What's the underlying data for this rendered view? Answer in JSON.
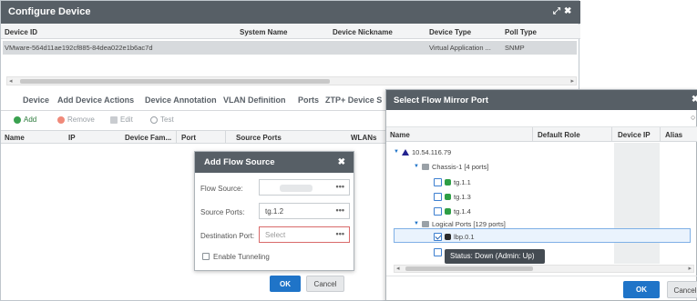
{
  "configure_device": {
    "title": "Configure Device",
    "maximize_glyph": "⤢",
    "close_glyph": "✖",
    "columns": [
      "Device ID",
      "System Name",
      "Device Nickname",
      "Device Type",
      "Poll Type"
    ],
    "row": {
      "device_id": "VMware-564d11ae192cf885-84dea022e1b6ac7d",
      "system_name": "",
      "device_nickname": "",
      "device_type": "Virtual Application ...",
      "poll_type": "SNMP"
    },
    "scroll_left": "◂",
    "scroll_right": "▸",
    "tabs": [
      "Device",
      "Add Device Actions",
      "Device Annotation",
      "VLAN Definition",
      "Ports",
      "ZTP+ Device S"
    ],
    "toolbar": {
      "add": "Add",
      "remove": "Remove",
      "edit": "Edit",
      "test": "Test"
    },
    "grid_columns": [
      "Name",
      "IP",
      "Device Fam...",
      "Port",
      "Source Ports",
      "WLANs"
    ]
  },
  "add_flow_source": {
    "title": "Add Flow Source",
    "close_glyph": "✖",
    "flow_source_label": "Flow Source:",
    "source_ports_label": "Source Ports:",
    "source_ports_value": "tg.1.2",
    "destination_port_label": "Destination Port:",
    "destination_port_placeholder": "Select",
    "dots": "•••",
    "enable_tunneling_label": "Enable Tunneling",
    "ok": "OK",
    "cancel": "Cancel"
  },
  "select_flow_mirror_port": {
    "title": "Select Flow Mirror Port",
    "close_glyph": "✖",
    "search_glyph": "○",
    "columns": [
      "Name",
      "Default Role",
      "Device IP",
      "Alias"
    ],
    "tree": {
      "root": "10.54.116.79",
      "chassis": "Chassis-1 [4 ports]",
      "ports": [
        "tg.1.1",
        "tg.1.3",
        "tg.1.4"
      ],
      "logical": "Logical Ports [129 ports]",
      "selected_port": "lbp.0.1"
    },
    "tooltip": "Status: Down (Admin: Up)",
    "scroll_left": "◂",
    "scroll_right": "▸",
    "ok": "OK",
    "cancel": "Cancel"
  }
}
